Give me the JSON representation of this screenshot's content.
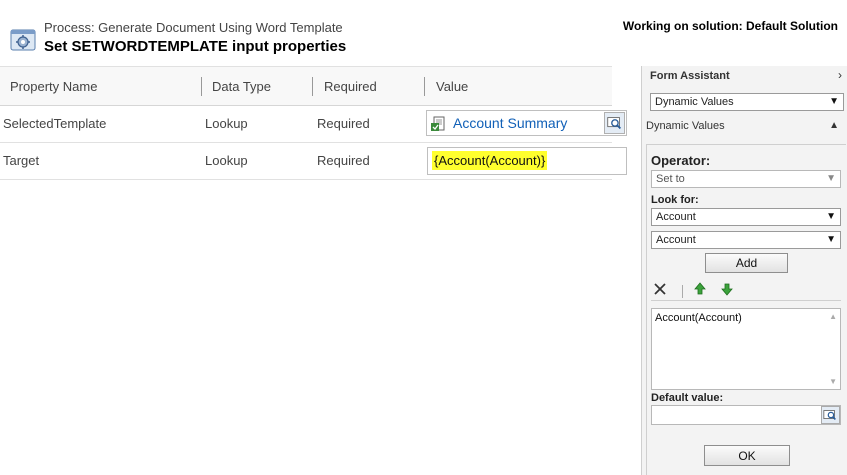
{
  "header": {
    "process_label": "Process: Generate Document Using Word Template",
    "title": "Set SETWORDTEMPLATE input properties",
    "solution_label": "Working on solution: Default Solution",
    "icon": "process-gear-icon"
  },
  "grid": {
    "columns": [
      "Property Name",
      "Data Type",
      "Required",
      "Value"
    ],
    "rows": [
      {
        "name": "SelectedTemplate",
        "type": "Lookup",
        "required": "Required",
        "value": "Account Summary"
      },
      {
        "name": "Target",
        "type": "Lookup",
        "required": "Required",
        "value": "{Account(Account)}"
      }
    ],
    "highlight_color": "#ffff2e",
    "link_color": "#1160b7"
  },
  "assistant": {
    "title": "Form Assistant",
    "mode_select": "Dynamic Values",
    "section_label": "Dynamic Values",
    "operator_label": "Operator:",
    "operator_value": "Set to",
    "look_for_label": "Look for:",
    "look_for_entity": "Account",
    "look_for_attribute": "Account",
    "add_label": "Add",
    "dynamic_value_item": "Account(Account)",
    "default_value_label": "Default value:",
    "ok_label": "OK",
    "icons": [
      "delete-x-icon",
      "move-up-arrow-icon",
      "move-down-arrow-icon",
      "lookup-search-icon"
    ]
  }
}
